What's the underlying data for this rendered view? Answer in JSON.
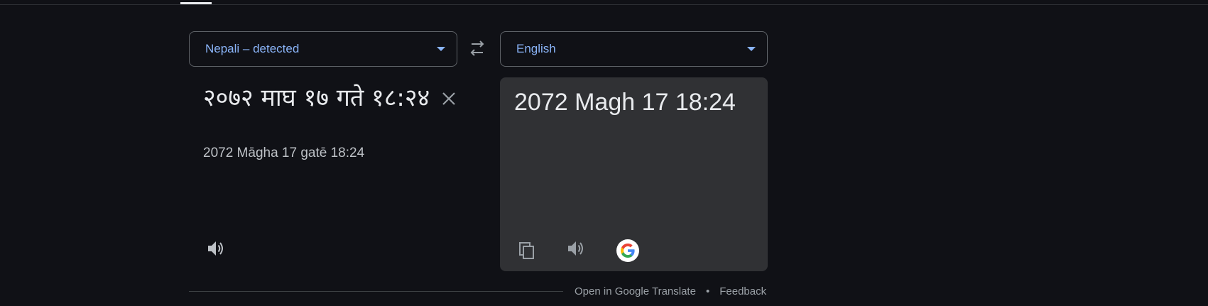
{
  "source_language": {
    "label": "Nepali – detected"
  },
  "target_language": {
    "label": "English"
  },
  "source": {
    "text": "२०७२ माघ १७ गते १८:२४",
    "transliteration": "2072 Māgha 17 gatē 18:24"
  },
  "target": {
    "text": "2072 Magh 17 18:24"
  },
  "footer": {
    "open_link": "Open in Google Translate",
    "separator": "•",
    "feedback_link": "Feedback"
  },
  "colors": {
    "background": "#101116",
    "panel": "#303134",
    "accent": "#8ab4f8",
    "text": "#e8eaed",
    "muted": "#9aa0a6"
  },
  "icons": {
    "swap": "swap-arrows-icon",
    "clear": "close-icon",
    "speaker": "speaker-icon",
    "copy": "copy-icon",
    "google": "google-logo-icon",
    "dropdown": "caret-down-icon"
  }
}
